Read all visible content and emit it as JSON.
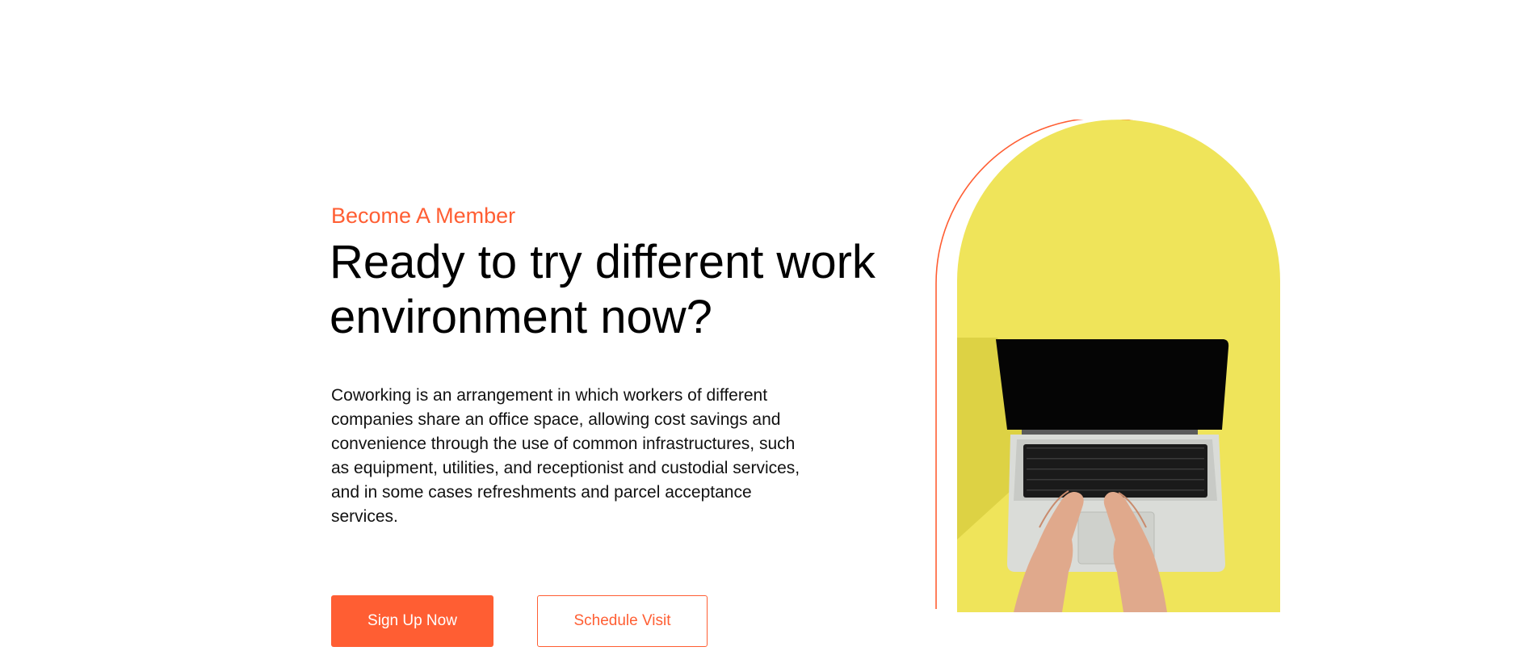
{
  "hero": {
    "eyebrow": "Become A Member",
    "headline": "Ready to try different work environment now?",
    "body": "Coworking is an arrangement in which workers of different companies share an office space, allowing cost savings and convenience through the use of common infrastructures, such as equipment, utilities, and receptionist and custodial services, and in some cases refreshments and parcel acceptance services.",
    "primary_button_label": "Sign Up Now",
    "secondary_button_label": "Schedule Visit"
  },
  "image": {
    "description_icon": "laptop-typing-illustration"
  },
  "colors": {
    "accent": "#ff5e33",
    "arch_fill": "#efe45a",
    "text": "#000000"
  }
}
